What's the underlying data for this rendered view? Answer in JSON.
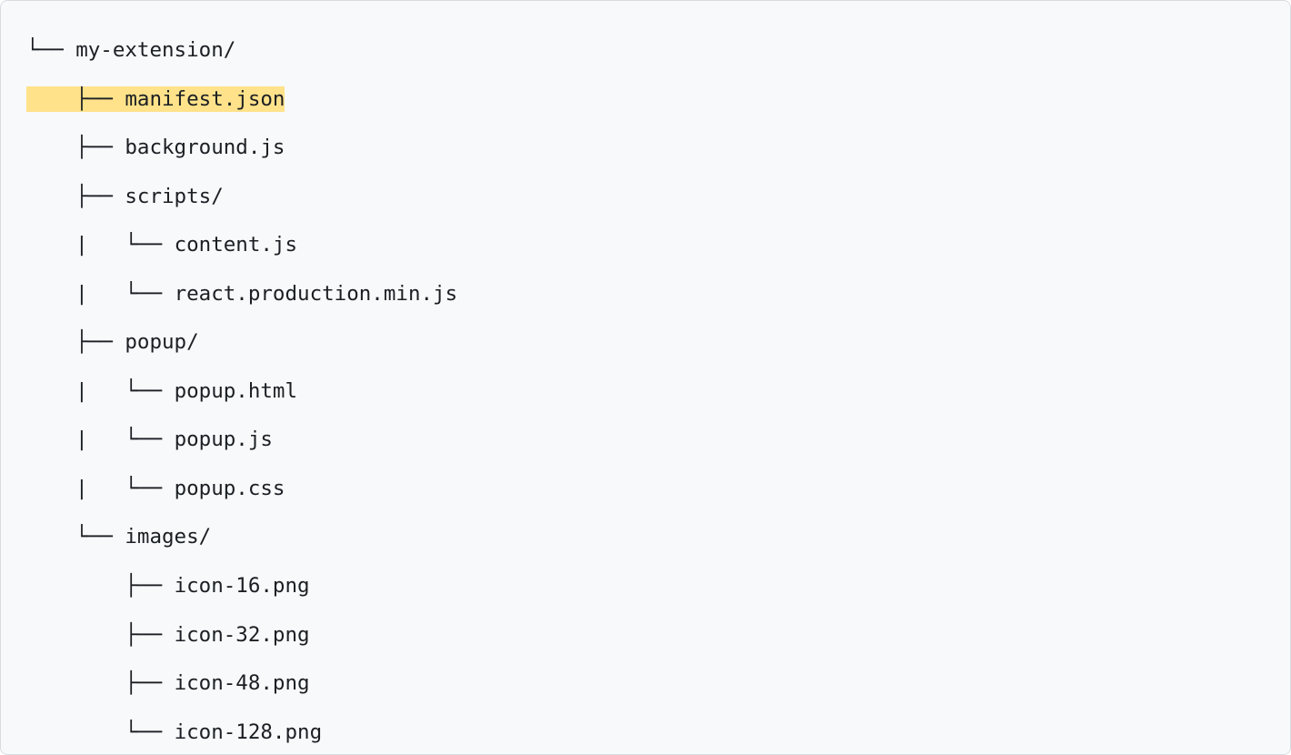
{
  "lines": [
    {
      "prefix": "└── ",
      "text": "my-extension/",
      "highlighted": false,
      "pad": ""
    },
    {
      "prefix": "    ├── ",
      "text": "manifest.json",
      "highlighted": true,
      "pad": "  "
    },
    {
      "prefix": "    ├── ",
      "text": "background.js",
      "highlighted": false,
      "pad": ""
    },
    {
      "prefix": "    ├── ",
      "text": "scripts/",
      "highlighted": false,
      "pad": ""
    },
    {
      "prefix": "    |   └── ",
      "text": "content.js",
      "highlighted": false,
      "pad": ""
    },
    {
      "prefix": "    |   └── ",
      "text": "react.production.min.js",
      "highlighted": false,
      "pad": ""
    },
    {
      "prefix": "    ├── ",
      "text": "popup/",
      "highlighted": false,
      "pad": ""
    },
    {
      "prefix": "    |   └── ",
      "text": "popup.html",
      "highlighted": false,
      "pad": ""
    },
    {
      "prefix": "    |   └── ",
      "text": "popup.js",
      "highlighted": false,
      "pad": ""
    },
    {
      "prefix": "    |   └── ",
      "text": "popup.css",
      "highlighted": false,
      "pad": ""
    },
    {
      "prefix": "    └── ",
      "text": "images/",
      "highlighted": false,
      "pad": ""
    },
    {
      "prefix": "        ├── ",
      "text": "icon-16.png",
      "highlighted": false,
      "pad": ""
    },
    {
      "prefix": "        ├── ",
      "text": "icon-32.png",
      "highlighted": false,
      "pad": ""
    },
    {
      "prefix": "        ├── ",
      "text": "icon-48.png",
      "highlighted": false,
      "pad": ""
    },
    {
      "prefix": "        └── ",
      "text": "icon-128.png",
      "highlighted": false,
      "pad": ""
    }
  ]
}
